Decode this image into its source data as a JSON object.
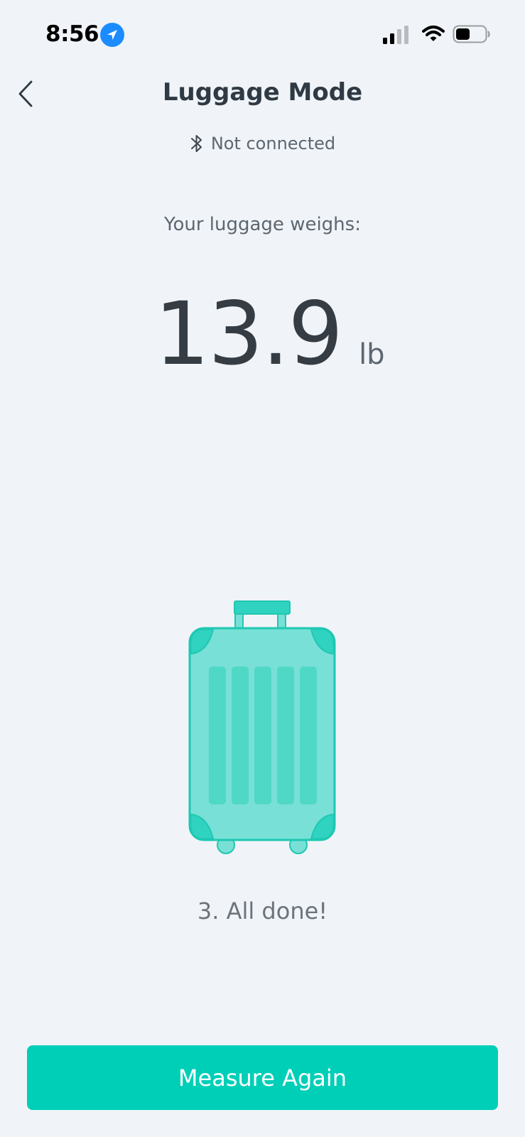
{
  "status_bar": {
    "time": "8:56"
  },
  "header": {
    "title": "Luggage Mode",
    "connection_status": "Not connected"
  },
  "main": {
    "weigh_label": "Your luggage weighs:",
    "weight_value": "13.9",
    "weight_unit": "lb",
    "step_text": "3. All done!"
  },
  "footer": {
    "measure_again_label": "Measure Again"
  },
  "colors": {
    "accent": "#00cfb8",
    "background": "#f0f4f8",
    "luggage_body": "#78e0d6",
    "luggage_dark": "#2fd3bf",
    "location_blue": "#1a8cff"
  },
  "icons": {
    "back": "chevron-left-icon",
    "bluetooth": "bluetooth-icon",
    "location": "location-arrow-icon",
    "signal": "cellular-signal-icon",
    "wifi": "wifi-icon",
    "battery": "battery-icon",
    "illustration": "luggage-icon"
  }
}
